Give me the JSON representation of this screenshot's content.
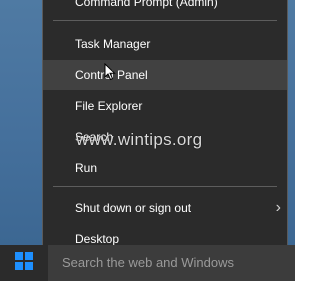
{
  "menu": {
    "items": [
      {
        "label": "Command Prompt (Admin)"
      },
      {
        "label": "Task Manager"
      },
      {
        "label": "Control Panel"
      },
      {
        "label": "File Explorer"
      },
      {
        "label": "Search"
      },
      {
        "label": "Run"
      },
      {
        "label": "Shut down or sign out"
      },
      {
        "label": "Desktop"
      }
    ]
  },
  "taskbar": {
    "search_placeholder": "Search the web and Windows"
  },
  "watermark": "www.wintips.org",
  "colors": {
    "menu_bg": "#2b2b2b",
    "menu_hover": "#414141",
    "taskbar_bg": "#1c1c1c",
    "windows_logo": "#1e90ff"
  }
}
